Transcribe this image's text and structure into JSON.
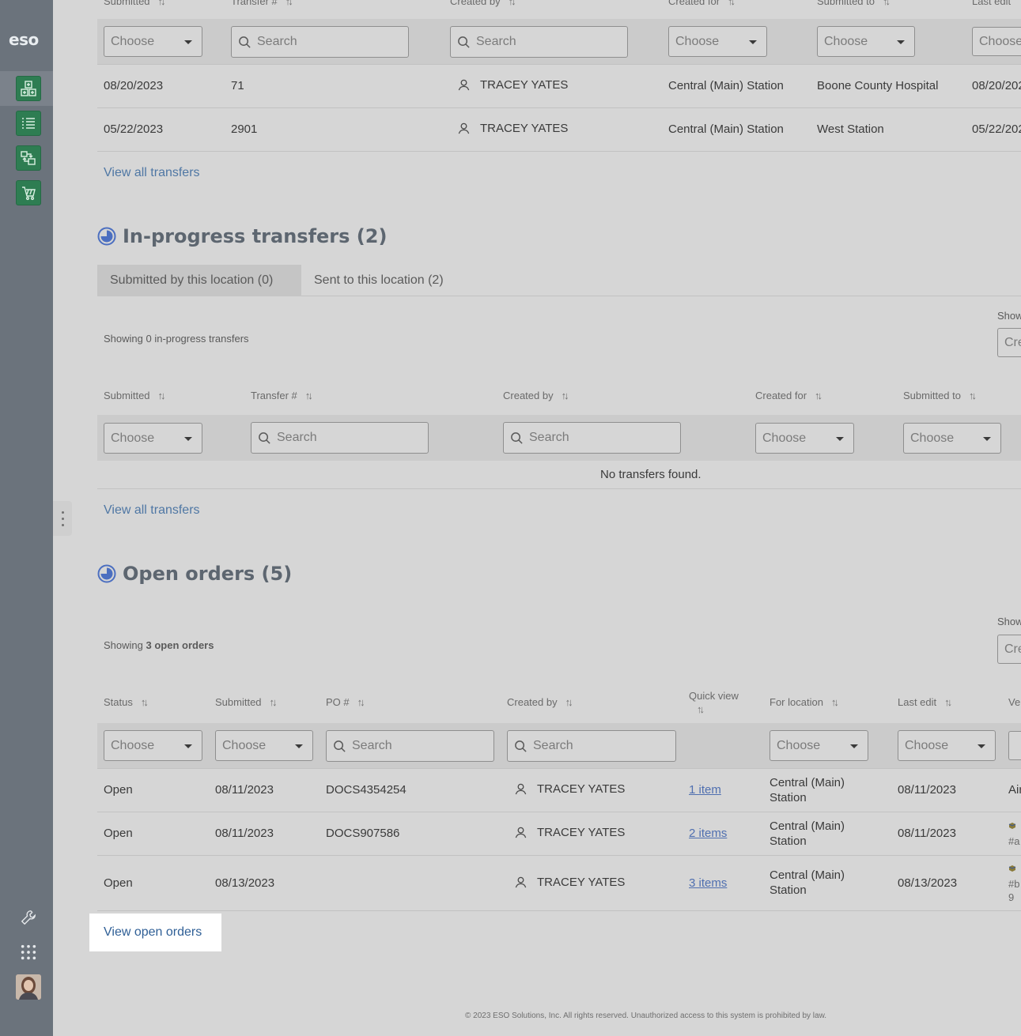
{
  "app": {
    "logo": "eso"
  },
  "sidebar": {
    "nav": [
      {
        "name": "dashboard-icon"
      },
      {
        "name": "list-icon"
      },
      {
        "name": "transfer-icon"
      },
      {
        "name": "cart-icon"
      }
    ],
    "utilities": [
      {
        "name": "wrench-icon"
      },
      {
        "name": "apps-grid-icon"
      },
      {
        "name": "avatar"
      }
    ]
  },
  "submitted_section": {
    "headers": [
      "Submitted",
      "Transfer #",
      "Created by",
      "Created for",
      "Submitted to",
      "Last edit"
    ],
    "filters": {
      "choose": "Choose",
      "search": "Search"
    },
    "rows": [
      {
        "submitted": "08/20/2023",
        "transfer": "71",
        "created_by": "TRACEY YATES",
        "created_for": "Central (Main) Station",
        "submitted_to": "Boone County Hospital",
        "last_edit": "08/20/202"
      },
      {
        "submitted": "05/22/2023",
        "transfer": "2901",
        "created_by": "TRACEY YATES",
        "created_for": "Central (Main) Station",
        "submitted_to": "West Station",
        "last_edit": "05/22/202"
      }
    ],
    "view_all": "View all transfers"
  },
  "in_progress": {
    "title": "In-progress transfers (2)",
    "tabs": [
      "Submitted by this location (0)",
      "Sent to this location (2)"
    ],
    "showing": "Showing 0 in-progress transfers",
    "show_label": "Show",
    "show_value": "Cre",
    "headers": [
      "Submitted",
      "Transfer #",
      "Created by",
      "Created for",
      "Submitted to"
    ],
    "empty": "No transfers found.",
    "view_all": "View all transfers"
  },
  "open_orders": {
    "title": "Open orders (5)",
    "showing_prefix": "Showing",
    "showing_bold": "3 open orders",
    "show_label": "Show",
    "show_value": "Cre",
    "headers": [
      "Status",
      "Submitted",
      "PO #",
      "Created by",
      "Quick view",
      "For location",
      "Last edit",
      "Ve"
    ],
    "rows": [
      {
        "status": "Open",
        "submitted": "08/11/2023",
        "po": "DOCS4354254",
        "created_by": "TRACEY YATES",
        "quick_view": "1 item",
        "location": "Central (Main) Station",
        "last_edit": "08/11/2023",
        "vendor": "Air"
      },
      {
        "status": "Open",
        "submitted": "08/11/2023",
        "po": "DOCS907586",
        "created_by": "TRACEY YATES",
        "quick_view": "2 items",
        "location": "Central (Main) Station",
        "last_edit": "08/11/2023",
        "vendor": "#a"
      },
      {
        "status": "Open",
        "submitted": "08/13/2023",
        "po": "",
        "created_by": "TRACEY YATES",
        "quick_view": "3 items",
        "location": "Central (Main) Station",
        "last_edit": "08/13/2023",
        "vendor": "#b",
        "vendor_line2": "9"
      }
    ],
    "view_orders": "View open orders"
  },
  "footer": "© 2023 ESO Solutions, Inc. All rights reserved. Unauthorized access to this system is prohibited by law."
}
